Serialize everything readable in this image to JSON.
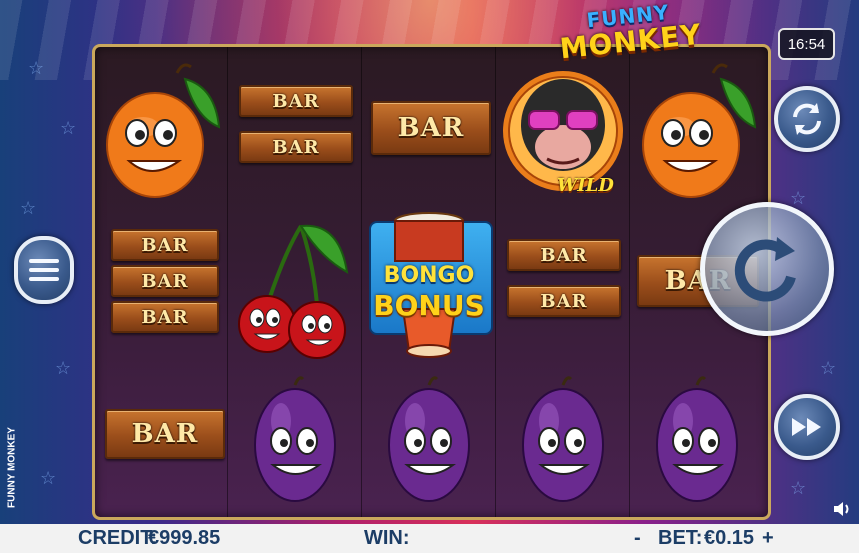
{
  "game": {
    "title_line1": "FUNNY",
    "title_line2": "MONKEY",
    "side_label": "FUNNY MONKEY",
    "clock": "16:54"
  },
  "symbols": {
    "bar_label": "BAR",
    "wild_label": "WILD",
    "bonus_line1": "BONGO",
    "bonus_line2": "BONUS"
  },
  "reels": [
    [
      "orange",
      "bar-triple",
      "bar-single"
    ],
    [
      "bar-double",
      "cherries",
      "plum"
    ],
    [
      "bar-single",
      "bongo-bonus",
      "plum"
    ],
    [
      "wild-monkey",
      "bar-double",
      "plum"
    ],
    [
      "orange",
      "bar-single",
      "plum"
    ]
  ],
  "controls": {
    "menu_icon": "hamburger-icon",
    "autoplay_icon": "autoplay-icon",
    "spin_icon": "spin-icon",
    "turbo_icon": "fast-forward-icon",
    "sound_icon": "speaker-icon"
  },
  "footer": {
    "credit_label": "CREDIT:",
    "credit_value": "€999.85",
    "win_label": "WIN:",
    "win_value": "",
    "bet_minus": "-",
    "bet_label": "BET:",
    "bet_value": "€0.15",
    "bet_plus": "+"
  },
  "colors": {
    "footer_text": "#1c3d66",
    "bar_text": "#ffe9a8",
    "frame_border": "#caa85c"
  }
}
